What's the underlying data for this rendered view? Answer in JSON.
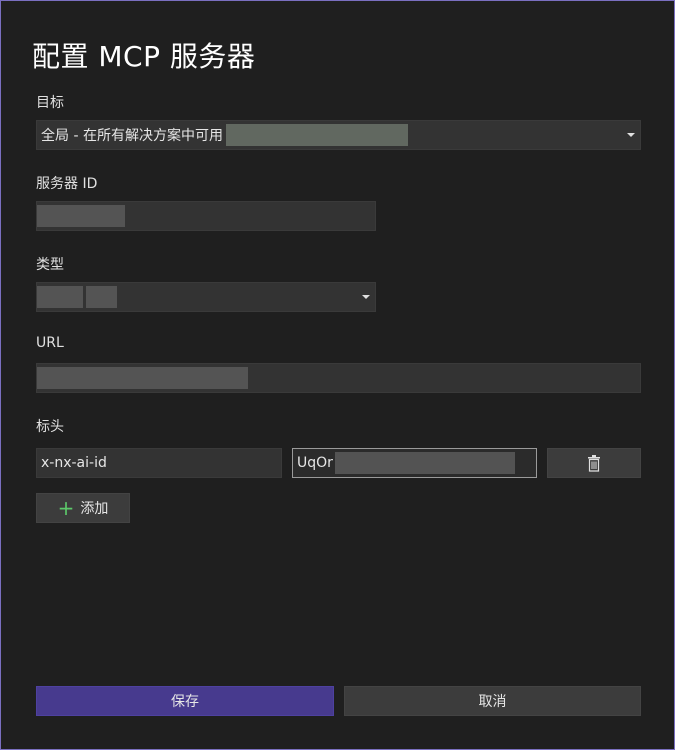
{
  "dialog": {
    "title": "配置 MCP 服务器"
  },
  "target": {
    "label": "目标",
    "value": "全局 - 在所有解决方案中可用"
  },
  "server_id": {
    "label": "服务器 ID",
    "value": ""
  },
  "type": {
    "label": "类型",
    "value": ""
  },
  "url": {
    "label": "URL",
    "value": ""
  },
  "headers": {
    "label": "标头",
    "rows": [
      {
        "name": "x-nx-ai-id",
        "value": "UqOr"
      }
    ],
    "add_label": "添加"
  },
  "footer": {
    "save_label": "保存",
    "cancel_label": "取消"
  },
  "colors": {
    "accent": "#473a8e",
    "add_icon": "#5cc96a",
    "border": "#7a6fc0"
  },
  "icons": {
    "delete": "trash-icon",
    "add": "plus-icon",
    "dropdown": "chevron-down-icon"
  }
}
